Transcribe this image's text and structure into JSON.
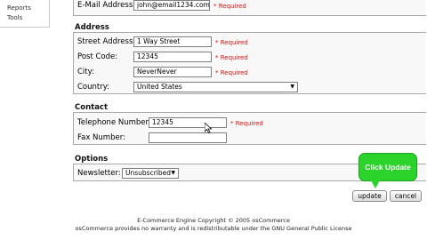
{
  "sidebar": {
    "items": [
      "Reports",
      "Tools"
    ]
  },
  "email": {
    "label": "E-Mail Address:",
    "value": "john@email1234.com",
    "required": "* Required"
  },
  "address": {
    "title": "Address",
    "street_label": "Street Address:",
    "street_value": "1 Way Street",
    "street_required": "* Required",
    "postcode_label": "Post Code:",
    "postcode_value": "12345",
    "postcode_required": "* Required",
    "city_label": "City:",
    "city_value": "NeverNever",
    "city_required": "* Required",
    "country_label": "Country:",
    "country_value": "United States"
  },
  "contact": {
    "title": "Contact",
    "phone_label": "Telephone Number:",
    "phone_value": "12345",
    "phone_required": "* Required",
    "fax_label": "Fax Number:",
    "fax_value": ""
  },
  "options": {
    "title": "Options",
    "newsletter_label": "Newsletter:",
    "newsletter_value": "Unsubscribed"
  },
  "buttons": {
    "update": "update",
    "cancel": "cancel"
  },
  "callout": {
    "text": "Click Update"
  },
  "footer": {
    "line1": "E-Commerce Engine Copyright © 2005 osCommerce",
    "line2": "osCommerce provides no warranty and is redistributable under the GNU General Public License"
  },
  "colors": {
    "required": "#e01010",
    "callout": "#2bd32b"
  }
}
